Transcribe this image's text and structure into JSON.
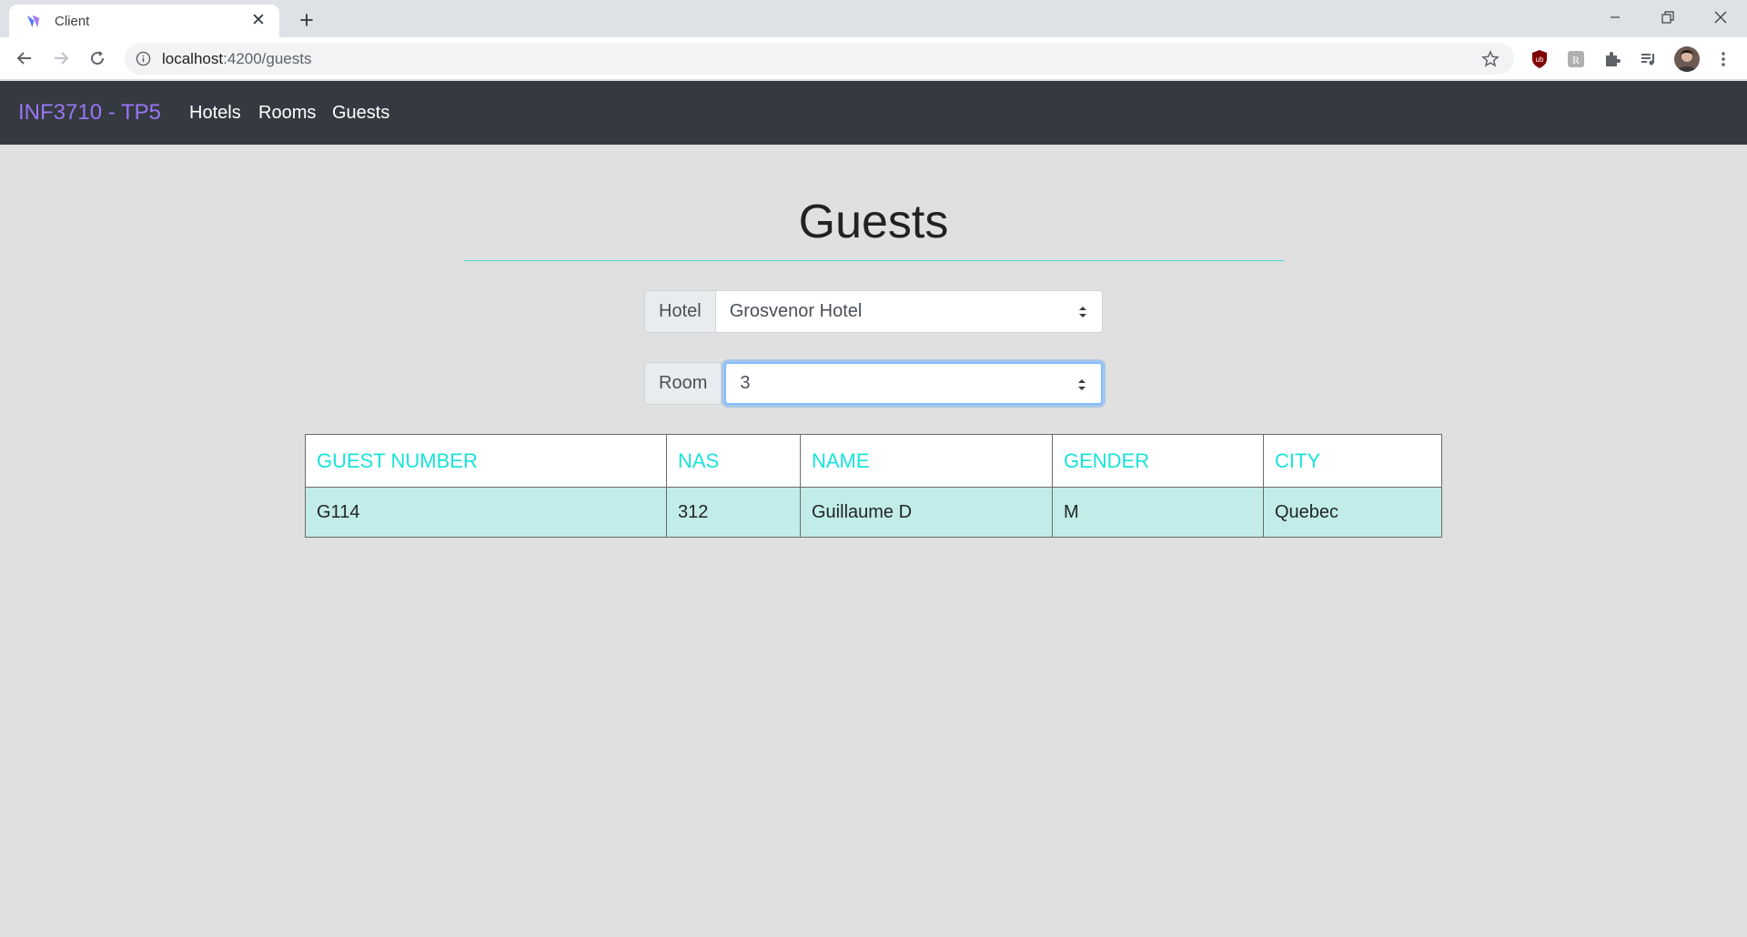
{
  "browser": {
    "tab_title": "Client",
    "url_host": "localhost",
    "url_path": ":4200/guests"
  },
  "navbar": {
    "brand": "INF3710 - TP5",
    "links": [
      "Hotels",
      "Rooms",
      "Guests"
    ]
  },
  "page": {
    "title": "Guests"
  },
  "filters": {
    "hotel_label": "Hotel",
    "hotel_value": "Grosvenor Hotel",
    "room_label": "Room",
    "room_value": "3"
  },
  "table": {
    "headers": [
      "GUEST NUMBER",
      "NAS",
      "NAME",
      "GENDER",
      "CITY"
    ],
    "rows": [
      [
        "G114",
        "312",
        "Guillaume D",
        "M",
        "Quebec"
      ]
    ]
  },
  "colors": {
    "brand": "#9a75f5",
    "navbar_bg": "#343a40",
    "header_text": "#19e3d9",
    "row_bg": "#c2ece9",
    "rule": "#44d2d2"
  }
}
